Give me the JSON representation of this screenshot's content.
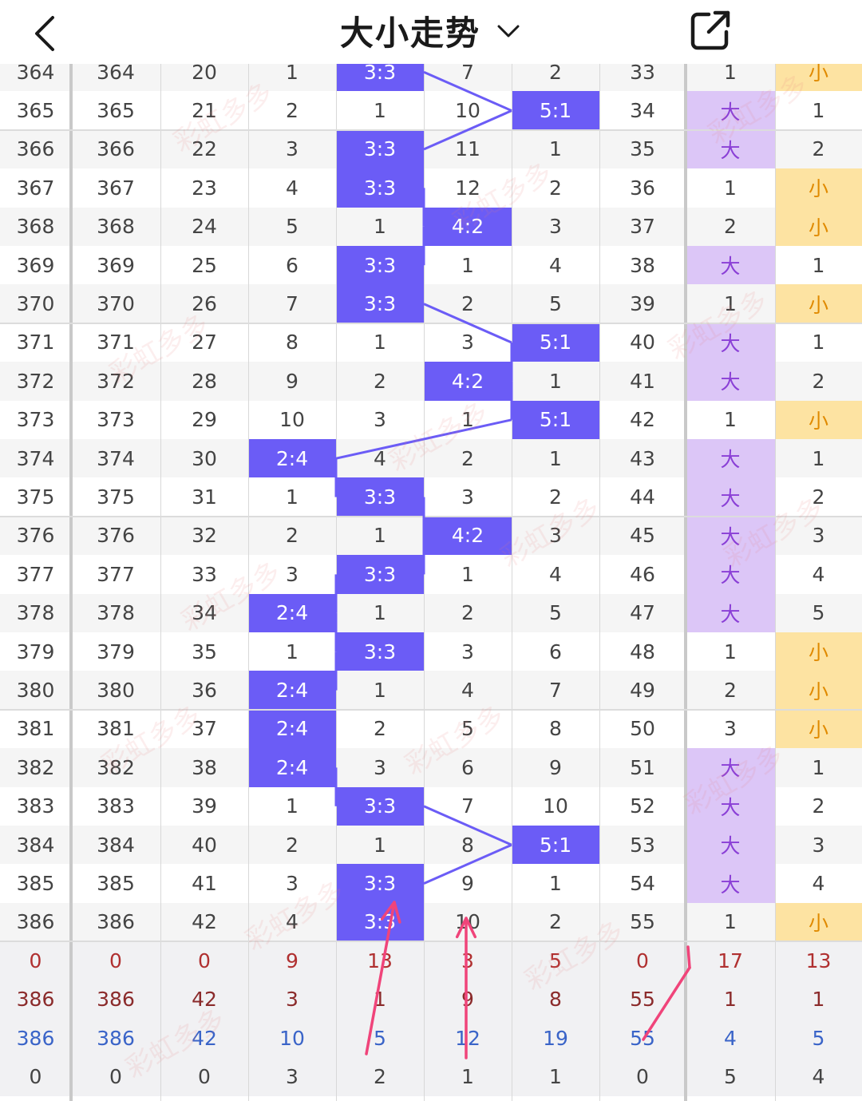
{
  "header": {
    "title": "大小走势",
    "back_icon": "chevron-left-icon",
    "dropdown_icon": "chevron-down-icon",
    "share_icon": "share-external-icon"
  },
  "colors": {
    "highlight_blue": "#6b5cf6",
    "big_bg": "#dcc6f7",
    "small_bg": "#fde3a2",
    "arrow": "#f0447a"
  },
  "columns_count": 10,
  "top_partial_row": [
    "364",
    "364",
    "20",
    "1",
    "3:3",
    "7",
    "2",
    "33",
    "1",
    "小"
  ],
  "rows": [
    {
      "c": [
        "365",
        "365",
        "21",
        "2",
        "1",
        "10",
        "5:1",
        "34",
        "大",
        "1"
      ],
      "h": 6,
      "bs": "big"
    },
    {
      "c": [
        "366",
        "366",
        "22",
        "3",
        "3:3",
        "11",
        "1",
        "35",
        "大",
        "2"
      ],
      "h": 4,
      "bs": "big"
    },
    {
      "c": [
        "367",
        "367",
        "23",
        "4",
        "3:3",
        "12",
        "2",
        "36",
        "1",
        "小"
      ],
      "h": 4,
      "bs": "small"
    },
    {
      "c": [
        "368",
        "368",
        "24",
        "5",
        "1",
        "4:2",
        "3",
        "37",
        "2",
        "小"
      ],
      "h": 5,
      "bs": "small"
    },
    {
      "c": [
        "369",
        "369",
        "25",
        "6",
        "3:3",
        "1",
        "4",
        "38",
        "大",
        "1"
      ],
      "h": 4,
      "bs": "big"
    },
    {
      "c": [
        "370",
        "370",
        "26",
        "7",
        "3:3",
        "2",
        "5",
        "39",
        "1",
        "小"
      ],
      "h": 4,
      "bs": "small"
    },
    {
      "c": [
        "371",
        "371",
        "27",
        "8",
        "1",
        "3",
        "5:1",
        "40",
        "大",
        "1"
      ],
      "h": 6,
      "bs": "big"
    },
    {
      "c": [
        "372",
        "372",
        "28",
        "9",
        "2",
        "4:2",
        "1",
        "41",
        "大",
        "2"
      ],
      "h": 5,
      "bs": "big"
    },
    {
      "c": [
        "373",
        "373",
        "29",
        "10",
        "3",
        "1",
        "5:1",
        "42",
        "1",
        "小"
      ],
      "h": 6,
      "bs": "small"
    },
    {
      "c": [
        "374",
        "374",
        "30",
        "2:4",
        "4",
        "2",
        "1",
        "43",
        "大",
        "1"
      ],
      "h": 3,
      "bs": "big"
    },
    {
      "c": [
        "375",
        "375",
        "31",
        "1",
        "3:3",
        "3",
        "2",
        "44",
        "大",
        "2"
      ],
      "h": 4,
      "bs": "big"
    },
    {
      "c": [
        "376",
        "376",
        "32",
        "2",
        "1",
        "4:2",
        "3",
        "45",
        "大",
        "3"
      ],
      "h": 5,
      "bs": "big"
    },
    {
      "c": [
        "377",
        "377",
        "33",
        "3",
        "3:3",
        "1",
        "4",
        "46",
        "大",
        "4"
      ],
      "h": 4,
      "bs": "big"
    },
    {
      "c": [
        "378",
        "378",
        "34",
        "2:4",
        "1",
        "2",
        "5",
        "47",
        "大",
        "5"
      ],
      "h": 3,
      "bs": "big"
    },
    {
      "c": [
        "379",
        "379",
        "35",
        "1",
        "3:3",
        "3",
        "6",
        "48",
        "1",
        "小"
      ],
      "h": 4,
      "bs": "small"
    },
    {
      "c": [
        "380",
        "380",
        "36",
        "2:4",
        "1",
        "4",
        "7",
        "49",
        "2",
        "小"
      ],
      "h": 3,
      "bs": "small"
    },
    {
      "c": [
        "381",
        "381",
        "37",
        "2:4",
        "2",
        "5",
        "8",
        "50",
        "3",
        "小"
      ],
      "h": 3,
      "bs": "small"
    },
    {
      "c": [
        "382",
        "382",
        "38",
        "2:4",
        "3",
        "6",
        "9",
        "51",
        "大",
        "1"
      ],
      "h": 3,
      "bs": "big"
    },
    {
      "c": [
        "383",
        "383",
        "39",
        "1",
        "3:3",
        "7",
        "10",
        "52",
        "大",
        "2"
      ],
      "h": 4,
      "bs": "big"
    },
    {
      "c": [
        "384",
        "384",
        "40",
        "2",
        "1",
        "8",
        "5:1",
        "53",
        "大",
        "3"
      ],
      "h": 6,
      "bs": "big"
    },
    {
      "c": [
        "385",
        "385",
        "41",
        "3",
        "3:3",
        "9",
        "1",
        "54",
        "大",
        "4"
      ],
      "h": 4,
      "bs": "big"
    },
    {
      "c": [
        "386",
        "386",
        "42",
        "4",
        "3:3",
        "10",
        "2",
        "55",
        "1",
        "小"
      ],
      "h": 4,
      "bs": "small"
    }
  ],
  "stats": [
    {
      "c": [
        "0",
        "0",
        "0",
        "9",
        "13",
        "3",
        "5",
        "0",
        "17",
        "13"
      ],
      "color": "red"
    },
    {
      "c": [
        "386",
        "386",
        "42",
        "3",
        "1",
        "9",
        "8",
        "55",
        "1",
        "1"
      ],
      "color": "dred"
    },
    {
      "c": [
        "386",
        "386",
        "42",
        "10",
        "5",
        "12",
        "19",
        "55",
        "4",
        "5"
      ],
      "color": "blue"
    },
    {
      "c": [
        "0",
        "0",
        "0",
        "3",
        "2",
        "1",
        "1",
        "0",
        "5",
        "4"
      ],
      "color": "dark"
    }
  ],
  "watermark": "彩虹多多"
}
